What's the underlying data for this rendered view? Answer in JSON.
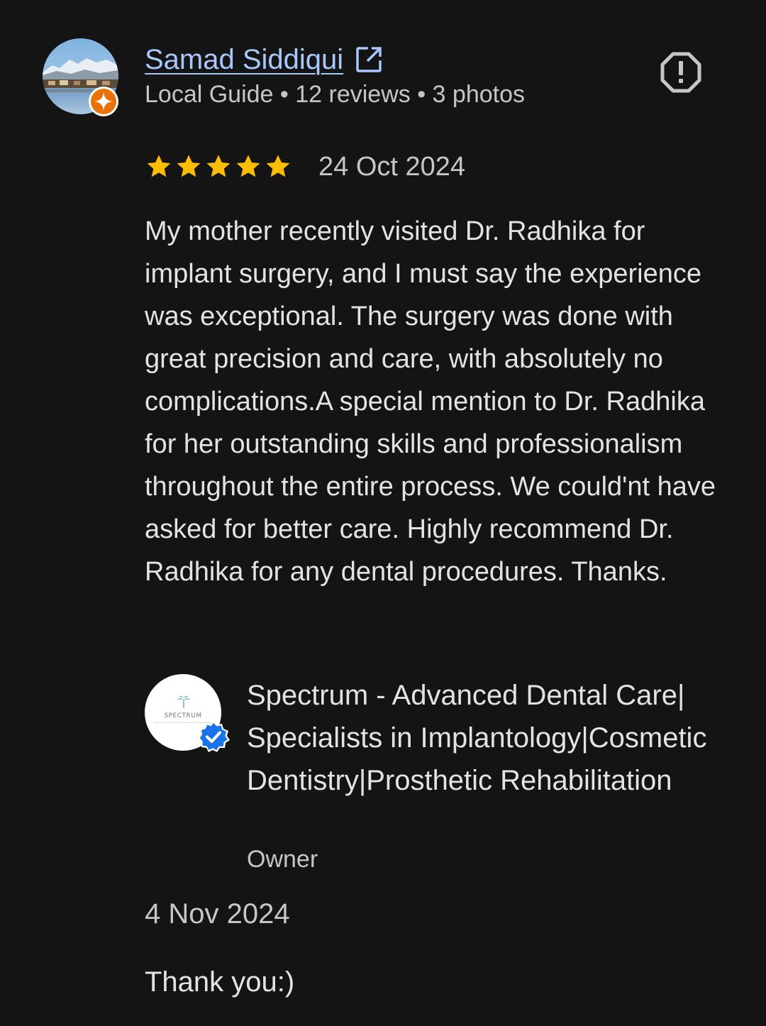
{
  "review": {
    "reviewer_name": "Samad Siddiqui",
    "reviewer_meta": "Local Guide • 12 reviews • 3 photos",
    "rating": 5,
    "rating_max": 5,
    "date": "24 Oct 2024",
    "text": "My mother recently visited Dr. Radhika for implant surgery, and I must say the experience was exceptional. The surgery was done with great precision and care, with absolutely no complications.A special mention to Dr. Radhika for her outstanding skills and professionalism throughout the entire process. We could'nt have asked for better care. Highly recommend Dr. Radhika for any dental procedures. Thanks."
  },
  "owner_response": {
    "business_name": "Spectrum - Advanced Dental Care| Specialists in Implantology|Cosmetic Dentistry|Prosthetic Rehabilitation",
    "logo_text": "SPECTRUM",
    "role": "Owner",
    "date": "4 Nov 2024",
    "text": "Thank you:)"
  },
  "icons": {
    "external_link": "open-in-new-icon",
    "report": "report-icon",
    "local_guide": "local-guide-badge-icon",
    "verified": "verified-badge-icon",
    "star": "star-icon"
  },
  "colors": {
    "background": "#141414",
    "link": "#a8c7fa",
    "star": "#fbbc04",
    "local_guide_badge": "#e8710a",
    "verified_badge": "#1a73e8"
  }
}
